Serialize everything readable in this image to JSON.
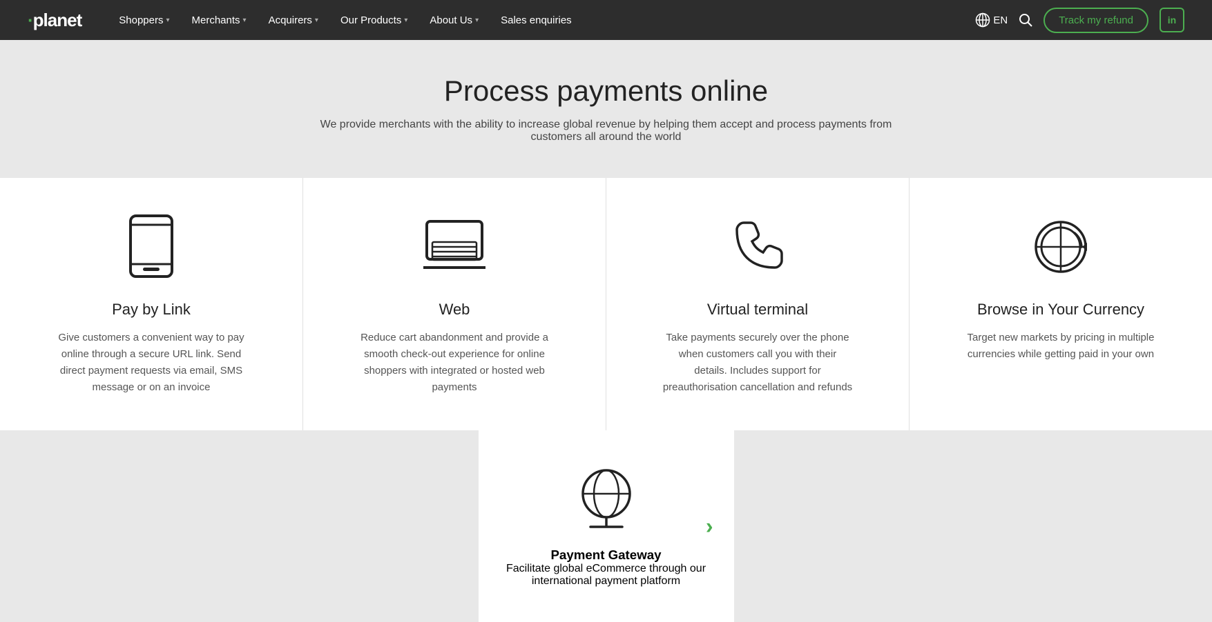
{
  "nav": {
    "logo": "·planet",
    "links": [
      {
        "label": "Shoppers",
        "hasDropdown": true
      },
      {
        "label": "Merchants",
        "hasDropdown": true
      },
      {
        "label": "Acquirers",
        "hasDropdown": true
      },
      {
        "label": "Our Products",
        "hasDropdown": true
      },
      {
        "label": "About Us",
        "hasDropdown": true
      },
      {
        "label": "Sales enquiries",
        "hasDropdown": false
      }
    ],
    "lang": "EN",
    "track_btn": "Track my refund",
    "linkedin_label": "in"
  },
  "hero": {
    "title": "Process payments online",
    "subtitle": "We provide merchants with the ability to increase global revenue by helping them accept and process payments from customers all around the world"
  },
  "cards": [
    {
      "title": "Pay by Link",
      "description": "Give customers a convenient way to pay online through a secure URL link. Send direct payment requests via email, SMS message or on an invoice",
      "icon": "phone-icon"
    },
    {
      "title": "Web",
      "description": "Reduce cart abandonment and provide a smooth check-out experience for online shoppers with integrated or hosted web payments",
      "icon": "laptop-icon"
    },
    {
      "title": "Virtual terminal",
      "description": "Take payments securely over the phone when customers call you with their details. Includes support for preauthorisation cancellation and refunds",
      "icon": "telephone-icon"
    },
    {
      "title": "Browse in Your Currency",
      "description": "Target new markets by pricing in multiple currencies while getting paid in your own",
      "icon": "globe-circle-icon"
    }
  ],
  "bottom_card": {
    "title": "Payment Gateway",
    "description": "Facilitate global eCommerce through our international payment platform",
    "icon": "globe-stand-icon"
  },
  "colors": {
    "green": "#4caf50",
    "dark": "#2d2d2d",
    "text": "#222222",
    "subtext": "#555555"
  }
}
